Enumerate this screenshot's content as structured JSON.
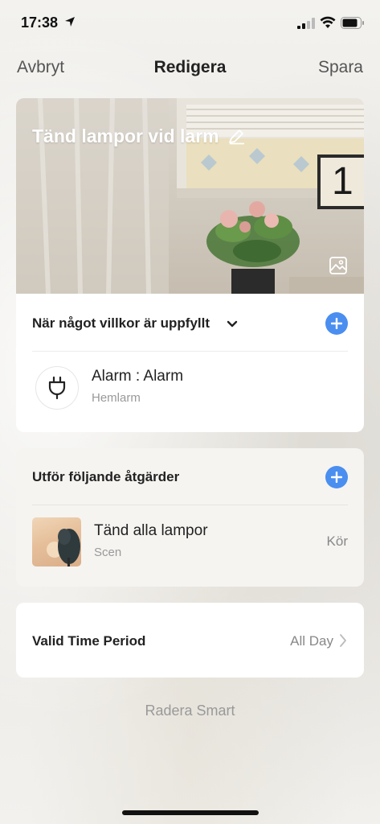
{
  "status_bar": {
    "time": "17:38"
  },
  "nav": {
    "cancel": "Avbryt",
    "title": "Redigera",
    "save": "Spara"
  },
  "scene": {
    "name": "Tänd lampor vid larm",
    "hero_digit": "1"
  },
  "conditions": {
    "heading": "När något villkor är uppfyllt",
    "items": [
      {
        "title": "Alarm : Alarm",
        "subtitle": "Hemlarm",
        "icon": "plug-icon"
      }
    ]
  },
  "actions": {
    "heading": "Utför följande åtgärder",
    "items": [
      {
        "title": "Tänd alla lampor",
        "subtitle": "Scen",
        "action": "Kör"
      }
    ]
  },
  "time_period": {
    "label": "Valid Time Period",
    "value": "All Day"
  },
  "delete_label": "Radera Smart",
  "colors": {
    "accent": "#4a8ef0",
    "text_primary": "#222222",
    "text_secondary": "#999999"
  }
}
